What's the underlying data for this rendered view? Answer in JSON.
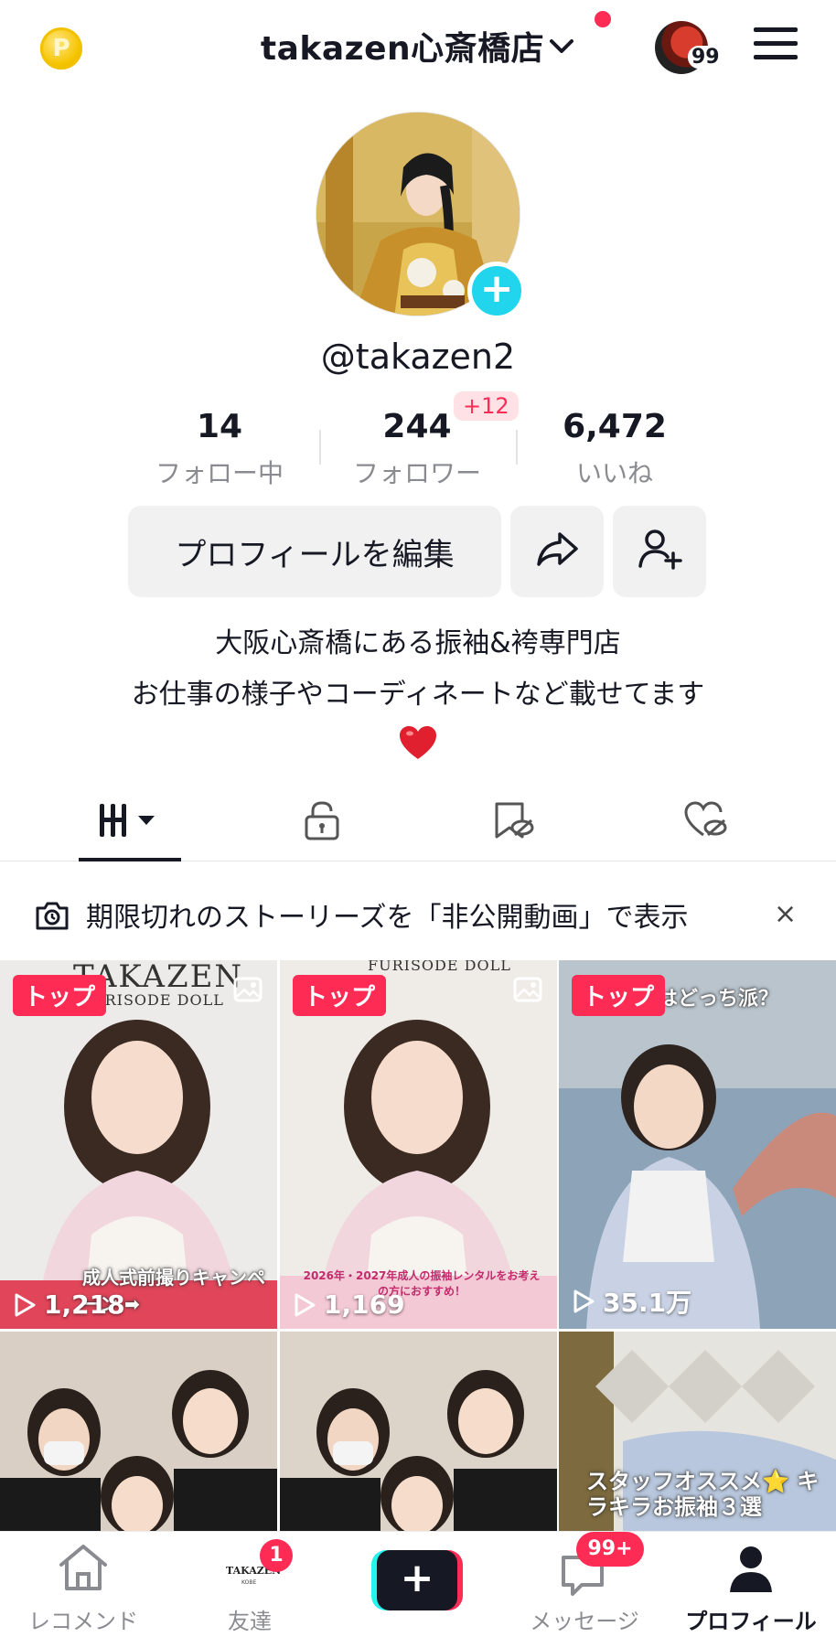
{
  "header": {
    "coin_label": "P",
    "account_name": "takazen心斎橋店",
    "inbox_count": "99"
  },
  "profile": {
    "username": "@takazen2",
    "stats": [
      {
        "value": "14",
        "label": "フォロー中"
      },
      {
        "value": "244",
        "label": "フォロワー"
      },
      {
        "value": "6,472",
        "label": "いいね"
      }
    ],
    "follower_delta": "+12",
    "edit_button": "プロフィールを編集",
    "bio_lines": [
      "大阪心斎橋にある振袖&袴専門店",
      "お仕事の様子やコーディネートなど載せてます"
    ]
  },
  "stories_banner": {
    "text": "期限切れのストーリーズを「非公開動画」で表示",
    "close": "×"
  },
  "videos": [
    {
      "pin": "トップ",
      "views": "1,218",
      "brand": "TAKAZEN",
      "brand_sub": "FURISODE DOLL",
      "caption": "成人式前撮りキャンペーン ➡"
    },
    {
      "pin": "トップ",
      "views": "1,169",
      "brand_sub": "FURISODE DOLL",
      "caption": "2026年・2027年成人の振袖レンタルをお考えの方におすすめ！"
    },
    {
      "pin": "トップ",
      "views": "35.1万",
      "caption": "はどっち派？"
    },
    {},
    {},
    {
      "caption": "スタッフオススメ⭐ キラキラお振袖３選"
    }
  ],
  "bottom_nav": {
    "items": [
      {
        "label": "レコメンド"
      },
      {
        "label": "友達",
        "badge": "1",
        "brand": "TAKAZEN",
        "brand_sub": "KOBE"
      },
      {
        "label": "+"
      },
      {
        "label": "メッセージ",
        "badge": "99+"
      },
      {
        "label": "プロフィール"
      }
    ]
  },
  "colors": {
    "accent": "#fe2c55",
    "cyan": "#20d5ec",
    "text": "#161823",
    "muted": "#8a8b91"
  }
}
